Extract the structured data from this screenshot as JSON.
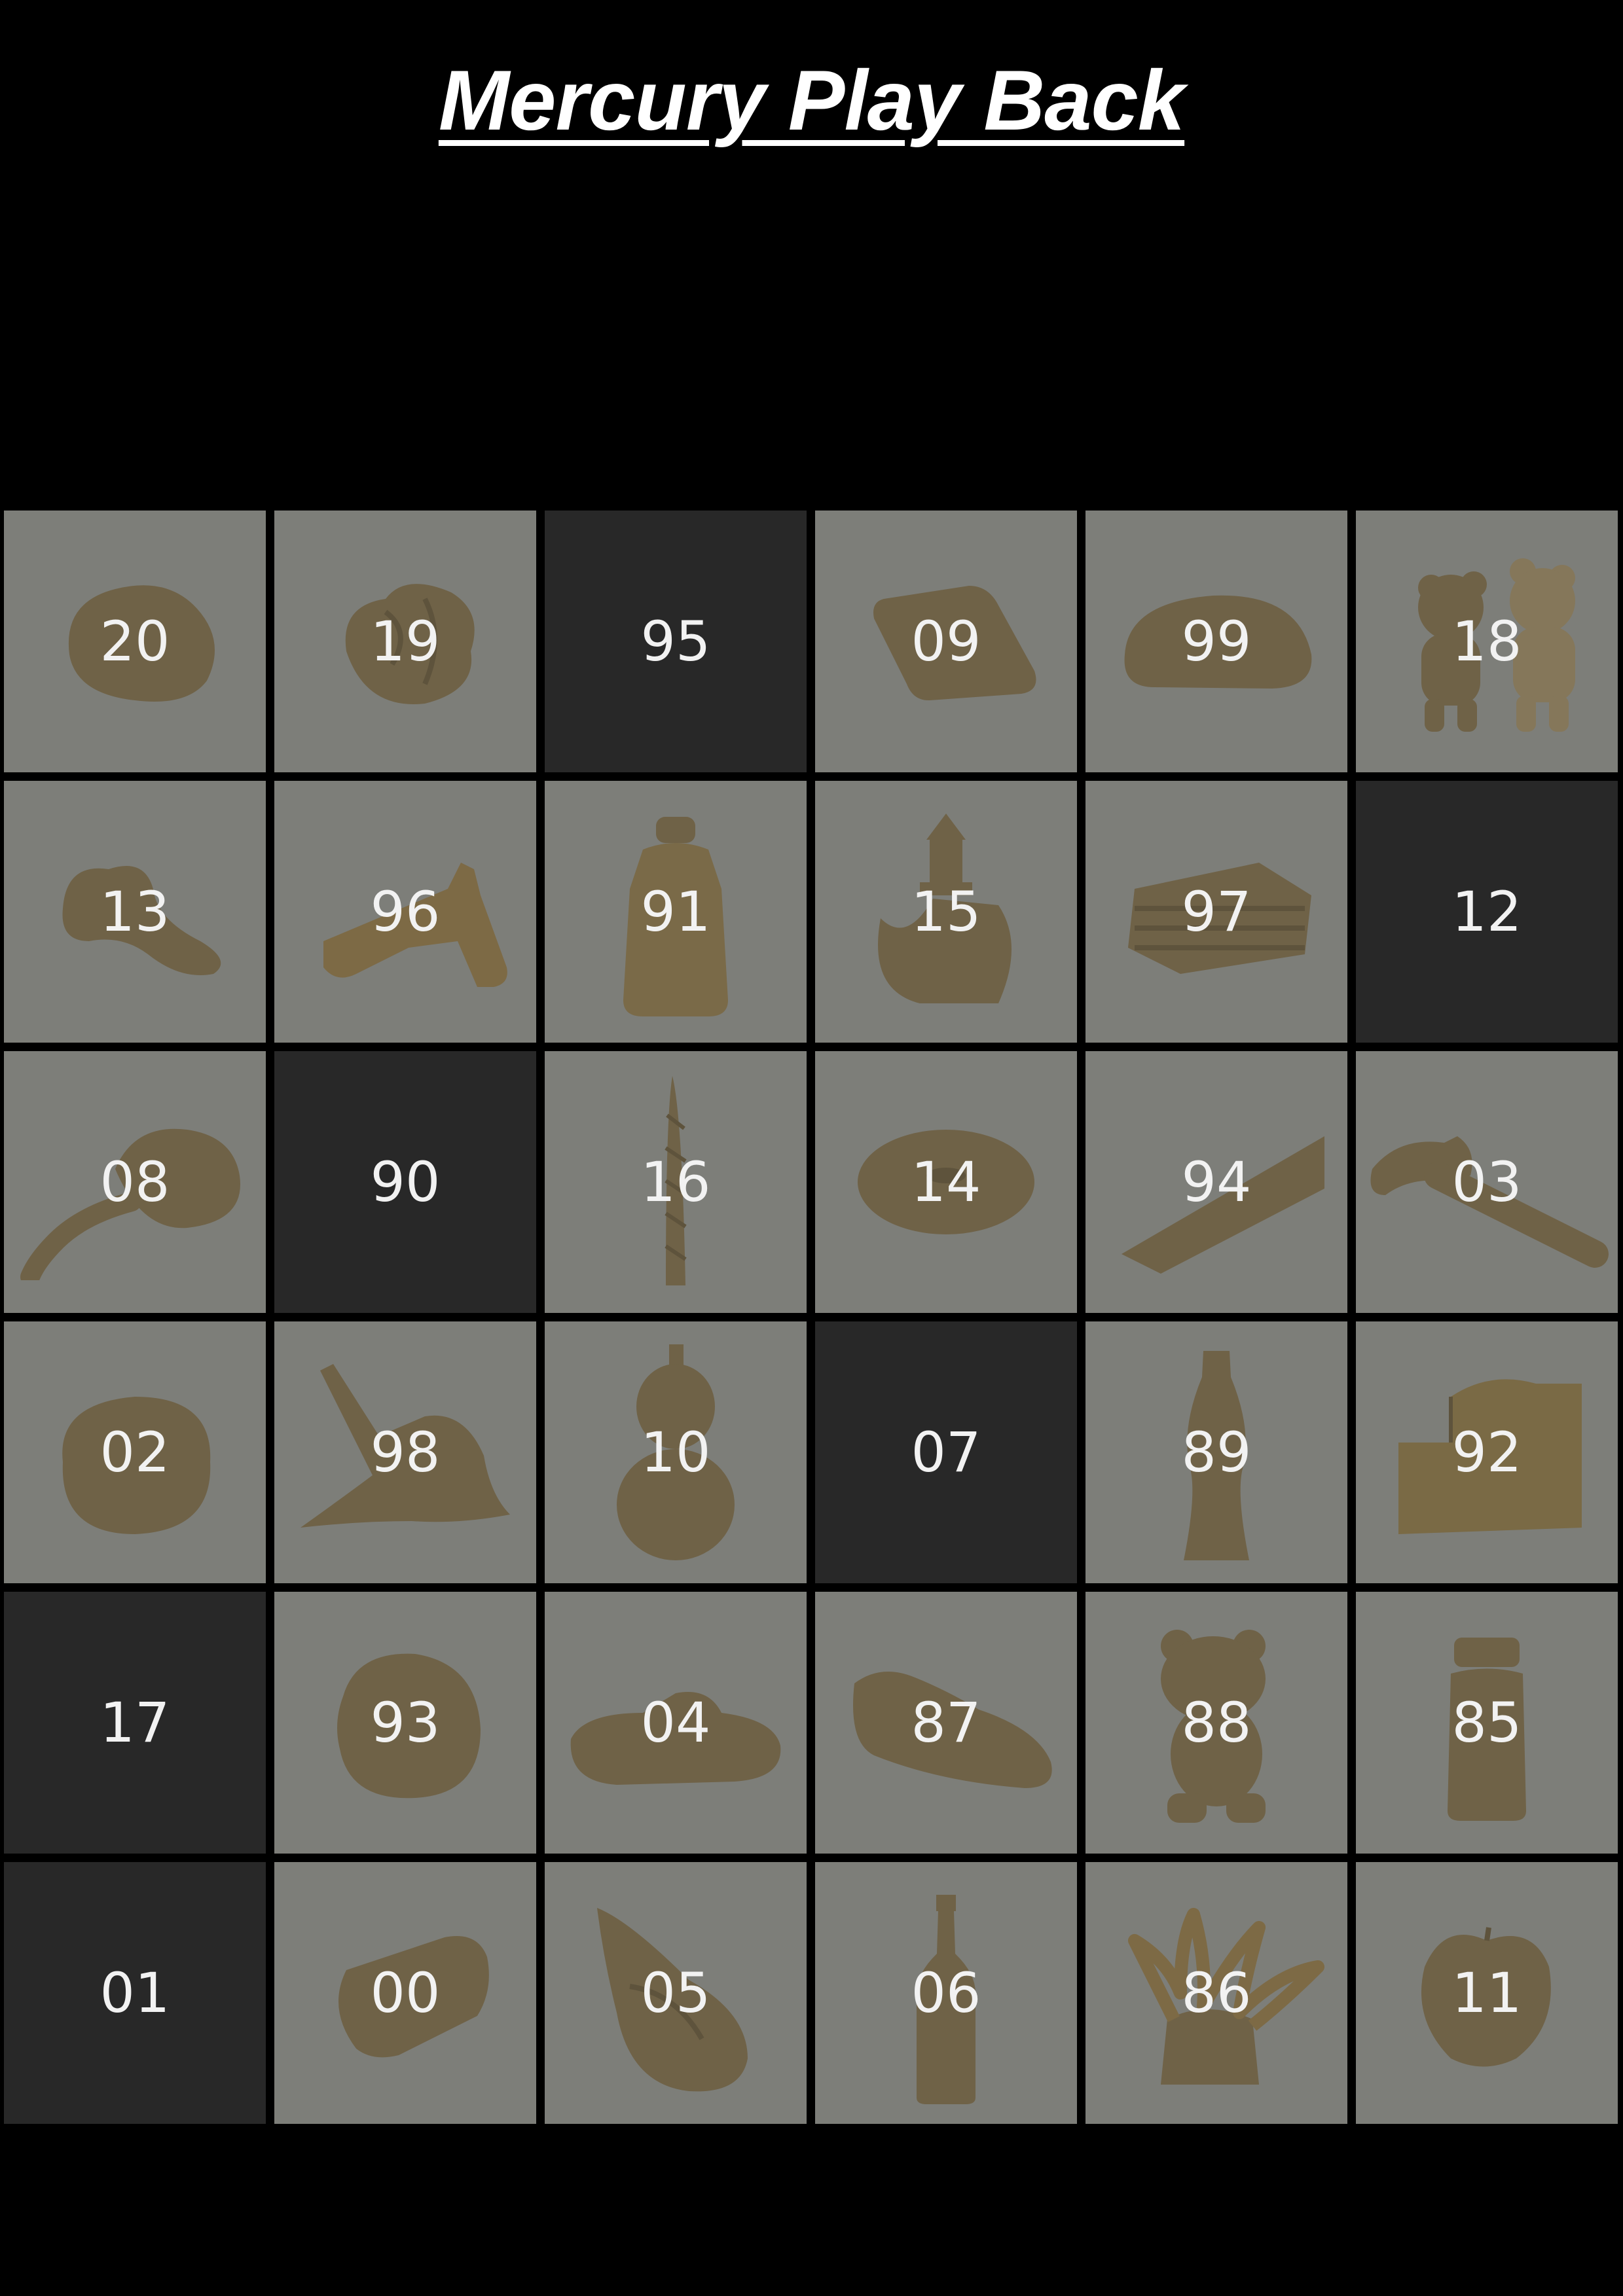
{
  "title": "Mercury Play Back",
  "colors": {
    "page_background": "#000000",
    "tile_background": "#7d7e79",
    "empty_tile_background": "#282828",
    "clay_color": "#6f6247",
    "label_color": "#f2f2f2"
  },
  "tiles": [
    {
      "label": "20",
      "object": "rock-icon",
      "empty": false
    },
    {
      "label": "19",
      "object": "crumpled-clay-icon",
      "empty": false
    },
    {
      "label": "95",
      "object": "",
      "empty": true
    },
    {
      "label": "09",
      "object": "tablet-icon",
      "empty": false
    },
    {
      "label": "99",
      "object": "bread-loaf-icon",
      "empty": false
    },
    {
      "label": "18",
      "object": "teddy-bears-icon",
      "empty": false
    },
    {
      "label": "13",
      "object": "bicycle-seat-icon",
      "empty": false
    },
    {
      "label": "96",
      "object": "pistol-icon",
      "empty": false
    },
    {
      "label": "91",
      "object": "milk-bottle-icon",
      "empty": false
    },
    {
      "label": "15",
      "object": "rubber-duck-icon",
      "empty": false
    },
    {
      "label": "97",
      "object": "stacked-blocks-icon",
      "empty": false
    },
    {
      "label": "12",
      "object": "",
      "empty": true
    },
    {
      "label": "08",
      "object": "mushroom-icon",
      "empty": false
    },
    {
      "label": "90",
      "object": "",
      "empty": true
    },
    {
      "label": "16",
      "object": "twisted-candle-icon",
      "empty": false
    },
    {
      "label": "14",
      "object": "donut-icon",
      "empty": false
    },
    {
      "label": "94",
      "object": "wedge-icon",
      "empty": false
    },
    {
      "label": "03",
      "object": "hammer-icon",
      "empty": false
    },
    {
      "label": "02",
      "object": "ball-icon",
      "empty": false
    },
    {
      "label": "98",
      "object": "melted-figure-icon",
      "empty": false
    },
    {
      "label": "10",
      "object": "gourd-icon",
      "empty": false
    },
    {
      "label": "07",
      "object": "",
      "empty": true
    },
    {
      "label": "89",
      "object": "soda-bottle-icon",
      "empty": false
    },
    {
      "label": "92",
      "object": "box-icon",
      "empty": false
    },
    {
      "label": "17",
      "object": "",
      "empty": true
    },
    {
      "label": "93",
      "object": "potato-icon",
      "empty": false
    },
    {
      "label": "04",
      "object": "slipper-icon",
      "empty": false
    },
    {
      "label": "87",
      "object": "sneaker-icon",
      "empty": false
    },
    {
      "label": "88",
      "object": "bear-figure-icon",
      "empty": false
    },
    {
      "label": "85",
      "object": "jar-icon",
      "empty": false
    },
    {
      "label": "01",
      "object": "",
      "empty": true
    },
    {
      "label": "00",
      "object": "soap-bar-icon",
      "empty": false
    },
    {
      "label": "05",
      "object": "seashell-icon",
      "empty": false
    },
    {
      "label": "06",
      "object": "bottle-icon",
      "empty": false
    },
    {
      "label": "86",
      "object": "leafy-plant-icon",
      "empty": false
    },
    {
      "label": "11",
      "object": "apple-icon",
      "empty": false
    }
  ]
}
